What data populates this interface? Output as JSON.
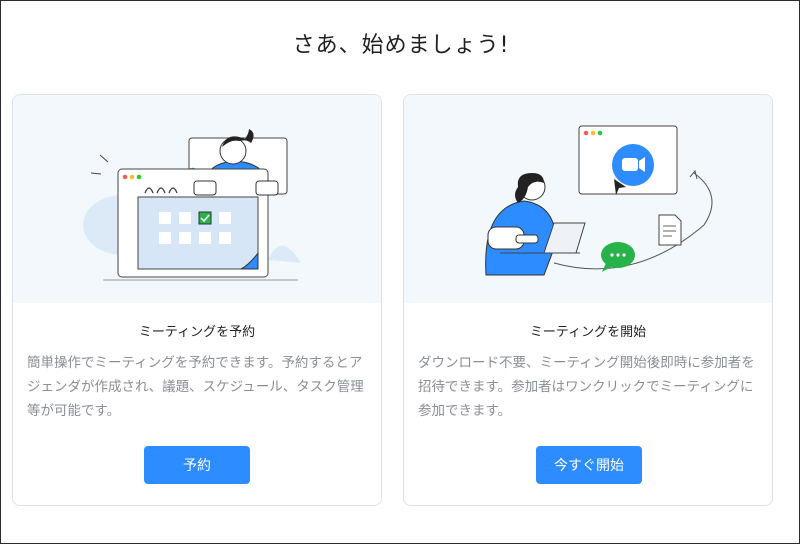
{
  "page": {
    "title": "さあ、始めましょう!"
  },
  "cards": [
    {
      "title": "ミーティングを予約",
      "description": "簡単操作でミーティングを予約できます。予約するとアジェンダが作成され、議題、スケジュール、タスク管理等が可能です。",
      "button_label": "予約",
      "illustration": "calendar-schedule-illustration"
    },
    {
      "title": "ミーティングを開始",
      "description": "ダウンロード不要、ミーティング開始後即時に参加者を招待できます。参加者はワンクリックでミーティングに参加できます。",
      "button_label": "今すぐ開始",
      "illustration": "video-meeting-illustration"
    }
  ],
  "colors": {
    "accent": "#2d8cff",
    "hero_background": "#f3f8fd",
    "card_border": "#dfe3e8",
    "chat_bubble": "#27b34a",
    "description_text": "#8a8f96"
  }
}
